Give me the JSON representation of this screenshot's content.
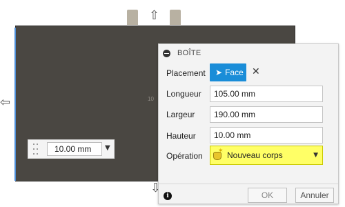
{
  "viewport": {
    "center_label": "10",
    "dimension_value": "10.00 mm"
  },
  "dialog": {
    "title": "BOÎTE",
    "placement": {
      "label": "Placement",
      "button_label": "Face"
    },
    "length": {
      "label": "Longueur",
      "value": "105.00 mm"
    },
    "width": {
      "label": "Largeur",
      "value": "190.00 mm"
    },
    "height": {
      "label": "Hauteur",
      "value": "10.00 mm"
    },
    "operation": {
      "label": "Opération",
      "value": "Nouveau corps"
    },
    "ok_label": "OK",
    "cancel_label": "Annuler"
  },
  "colors": {
    "accent": "#1a8dd8",
    "operation_highlight": "#ffff66",
    "body_face": "#4a4742"
  },
  "icons": [
    "arrow-up-icon",
    "arrow-left-icon",
    "arrow-down-icon",
    "collapse-icon",
    "cursor-icon",
    "close-icon",
    "new-body-icon",
    "chevron-down-icon",
    "info-icon"
  ]
}
